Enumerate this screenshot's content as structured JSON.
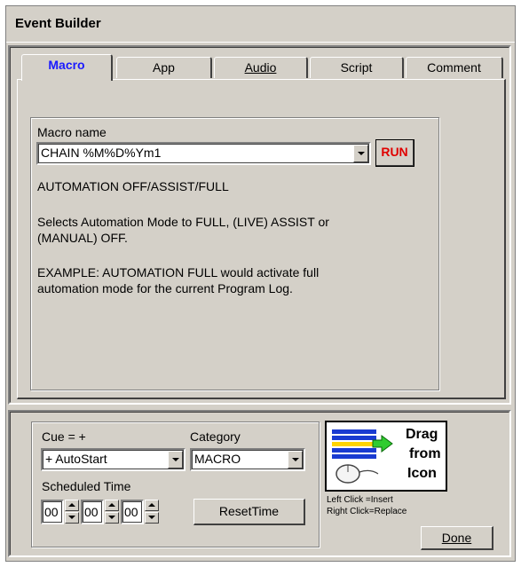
{
  "window": {
    "title": "Event Builder"
  },
  "tabs": [
    {
      "label": "Macro",
      "active": true
    },
    {
      "label": "App",
      "active": false
    },
    {
      "label": "Audio",
      "active": false
    },
    {
      "label": "Script",
      "active": false
    },
    {
      "label": "Comment",
      "active": false
    }
  ],
  "macro": {
    "name_label": "Macro name",
    "name_value": "CHAIN %M%D%Ym1",
    "run_label": "RUN",
    "heading": "AUTOMATION OFF/ASSIST/FULL",
    "description_line1": "Selects Automation Mode to FULL, (LIVE) ASSIST or",
    "description_line2": "(MANUAL) OFF.",
    "example_line1": "EXAMPLE: AUTOMATION FULL would activate full",
    "example_line2": "automation mode for the current Program Log."
  },
  "bottom": {
    "cue_label": "Cue = +",
    "cue_value": "+ AutoStart",
    "category_label": "Category",
    "category_value": "MACRO",
    "scheduled_label": "Scheduled Time",
    "hh": "00",
    "mm": "00",
    "ss": "00",
    "reset_label": "ResetTime",
    "drag_line1": "Drag",
    "drag_line2": "from",
    "drag_line3": "Icon",
    "left_click": "Left Click  =Insert",
    "right_click": "Right Click=Replace",
    "done_label": "Done"
  },
  "colors": {
    "run": "#e00000",
    "active_tab": "#1a1aff",
    "face": "#d4d0c8"
  }
}
